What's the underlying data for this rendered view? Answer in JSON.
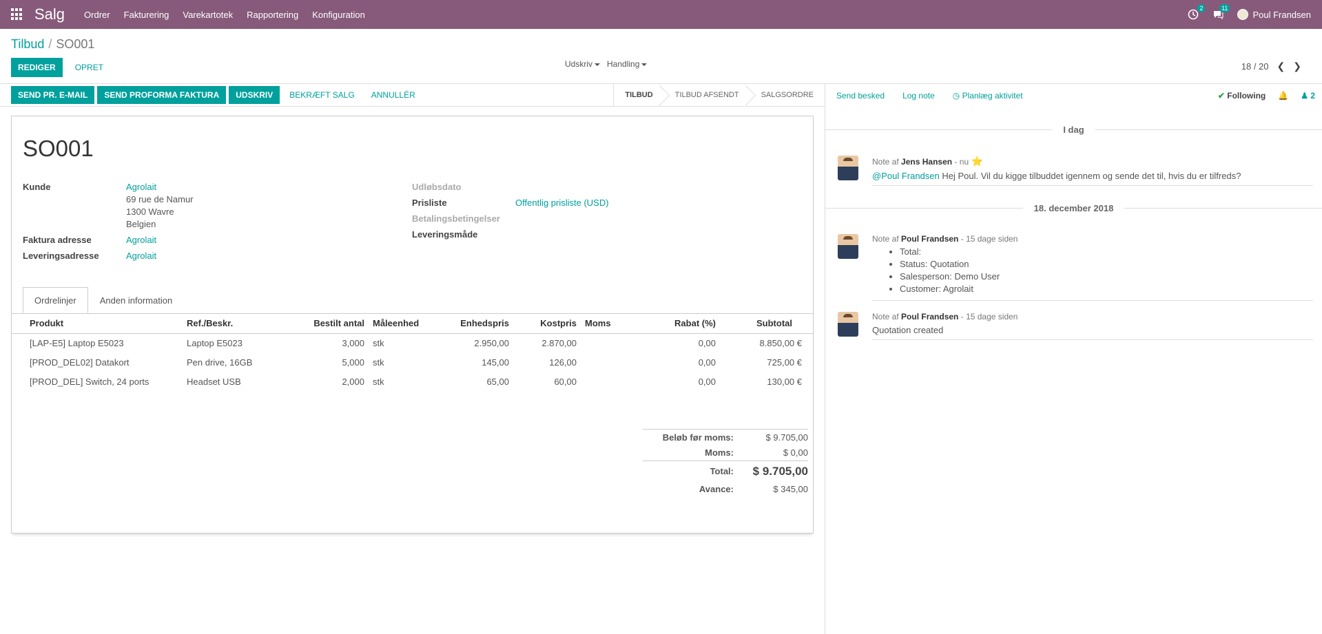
{
  "navbar": {
    "app_name": "Salg",
    "menu": [
      "Ordrer",
      "Fakturering",
      "Varekartotek",
      "Rapportering",
      "Konfiguration"
    ],
    "activity_count": "2",
    "messages_count": "11",
    "user_name": "Poul Frandsen"
  },
  "control_panel": {
    "breadcrumb_parent": "Tilbud",
    "breadcrumb_sep": "/",
    "breadcrumb_current": "SO001",
    "edit_label": "REDIGER",
    "create_label": "OPRET",
    "print_label": "Udskriv",
    "action_label": "Handling",
    "pager": "18 / 20"
  },
  "statusbar": {
    "buttons": [
      "SEND PR. E-MAIL",
      "SEND PROFORMA FAKTURA",
      "UDSKRIV"
    ],
    "confirm_label": "BEKRÆFT SALG",
    "cancel_label": "ANNULLÉR",
    "stages": [
      "TILBUD",
      "TILBUD AFSENDT",
      "SALGSORDRE"
    ],
    "active_stage": "TILBUD"
  },
  "form": {
    "name": "SO001",
    "customer_label": "Kunde",
    "customer_name": "Agrolait",
    "customer_address": [
      "69 rue de Namur",
      "1300 Wavre",
      "Belgien"
    ],
    "invoice_address_label": "Faktura adresse",
    "invoice_address": "Agrolait",
    "delivery_address_label": "Leveringsadresse",
    "delivery_address": "Agrolait",
    "expiry_label": "Udløbsdato",
    "pricelist_label": "Prisliste",
    "pricelist": "Offentlig prisliste (USD)",
    "payment_terms_label": "Betalingsbetingelser",
    "delivery_method_label": "Leveringsmåde"
  },
  "tabs": [
    "Ordrelinjer",
    "Anden information"
  ],
  "order_lines": {
    "headers": [
      "Produkt",
      "Ref./Beskr.",
      "Bestilt antal",
      "Måleenhed",
      "Enhedspris",
      "Kostpris",
      "Moms",
      "Rabat (%)",
      "Subtotal"
    ],
    "rows": [
      [
        "[LAP-E5] Laptop E5023",
        "Laptop E5023",
        "3,000",
        "stk",
        "2.950,00",
        "2.870,00",
        "",
        "0,00",
        "8.850,00 €"
      ],
      [
        "[PROD_DEL02] Datakort",
        "Pen drive, 16GB",
        "5,000",
        "stk",
        "145,00",
        "126,00",
        "",
        "0,00",
        "725,00 €"
      ],
      [
        "[PROD_DEL] Switch, 24 ports",
        "Headset USB",
        "2,000",
        "stk",
        "65,00",
        "60,00",
        "",
        "0,00",
        "130,00 €"
      ]
    ]
  },
  "totals": {
    "untaxed_label": "Beløb før moms:",
    "untaxed": "$ 9.705,00",
    "tax_label": "Moms:",
    "tax": "$ 0,00",
    "total_label": "Total:",
    "total": "$ 9.705,00",
    "margin_label": "Avance:",
    "margin": "$ 345,00"
  },
  "chatter": {
    "send_message": "Send besked",
    "log_note": "Log note",
    "schedule_activity": "Planlæg aktivitet",
    "following": "Following",
    "followers_count": "2",
    "today_label": "I dag",
    "date_label": "18. december 2018",
    "messages": [
      {
        "prefix": "Note af",
        "author": "Jens Hansen",
        "when": "- nu",
        "mention": "@Poul Frandsen",
        "text": " Hej Poul. Vil du kigge tilbuddet igennem og sende det til, hvis du er tilfreds?"
      },
      {
        "prefix": "Note af",
        "author": "Poul Frandsen",
        "when": "- 15 dage siden",
        "items": [
          "Total:",
          "Status: Quotation",
          "Salesperson: Demo User",
          "Customer: Agrolait"
        ]
      },
      {
        "prefix": "Note af",
        "author": "Poul Frandsen",
        "when": "- 15 dage siden",
        "text": "Quotation created"
      }
    ]
  }
}
